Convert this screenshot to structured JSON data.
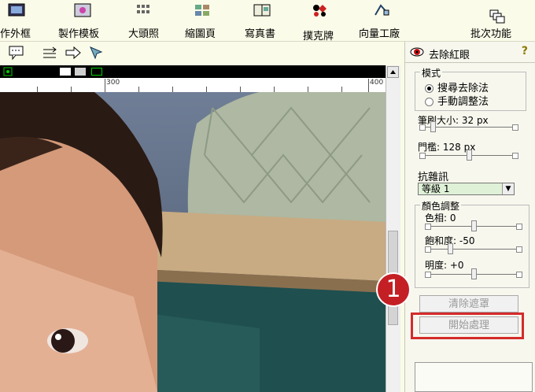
{
  "toolbar": {
    "items": [
      {
        "label": "作外框",
        "icon": "frame-icon"
      },
      {
        "label": "製作模板",
        "icon": "template-icon"
      },
      {
        "label": "大頭照",
        "icon": "id-photo-icon"
      },
      {
        "label": "縮圖頁",
        "icon": "thumbnail-page-icon"
      },
      {
        "label": "寫真書",
        "icon": "photo-book-icon"
      },
      {
        "label": "撲克牌",
        "icon": "poker-cards-icon"
      },
      {
        "label": "向量工廠",
        "icon": "vector-factory-icon"
      },
      {
        "label": "批次功能",
        "icon": "batch-icon"
      }
    ]
  },
  "ruler": {
    "labels": [
      "300",
      "400"
    ]
  },
  "panel": {
    "title": "去除紅眼",
    "mode": {
      "legend": "模式",
      "options": [
        "搜尋去除法",
        "手動調整法"
      ],
      "selected": 0
    },
    "brush": {
      "label": "筆刷大小: 32 px",
      "level": 0.12
    },
    "threshold": {
      "label": "門檻: 128 px",
      "level": 0.5
    },
    "noise": {
      "label": "抗雜訊",
      "selected": "等級 1"
    },
    "color": {
      "legend": "顏色調整",
      "hue": {
        "label": "色相: 0",
        "level": 0.5
      },
      "saturation": {
        "label": "飽和度: -50",
        "level": 0.25
      },
      "brightness": {
        "label": "明度: +0",
        "level": 0.5
      }
    },
    "buttons": {
      "clear": "清除遮罩",
      "start": "開始處理"
    }
  },
  "callout": {
    "number": "1"
  },
  "colors": {
    "highlight": "#d42b2b",
    "badge": "#c41f24",
    "select_bg": "#dff1d7"
  }
}
